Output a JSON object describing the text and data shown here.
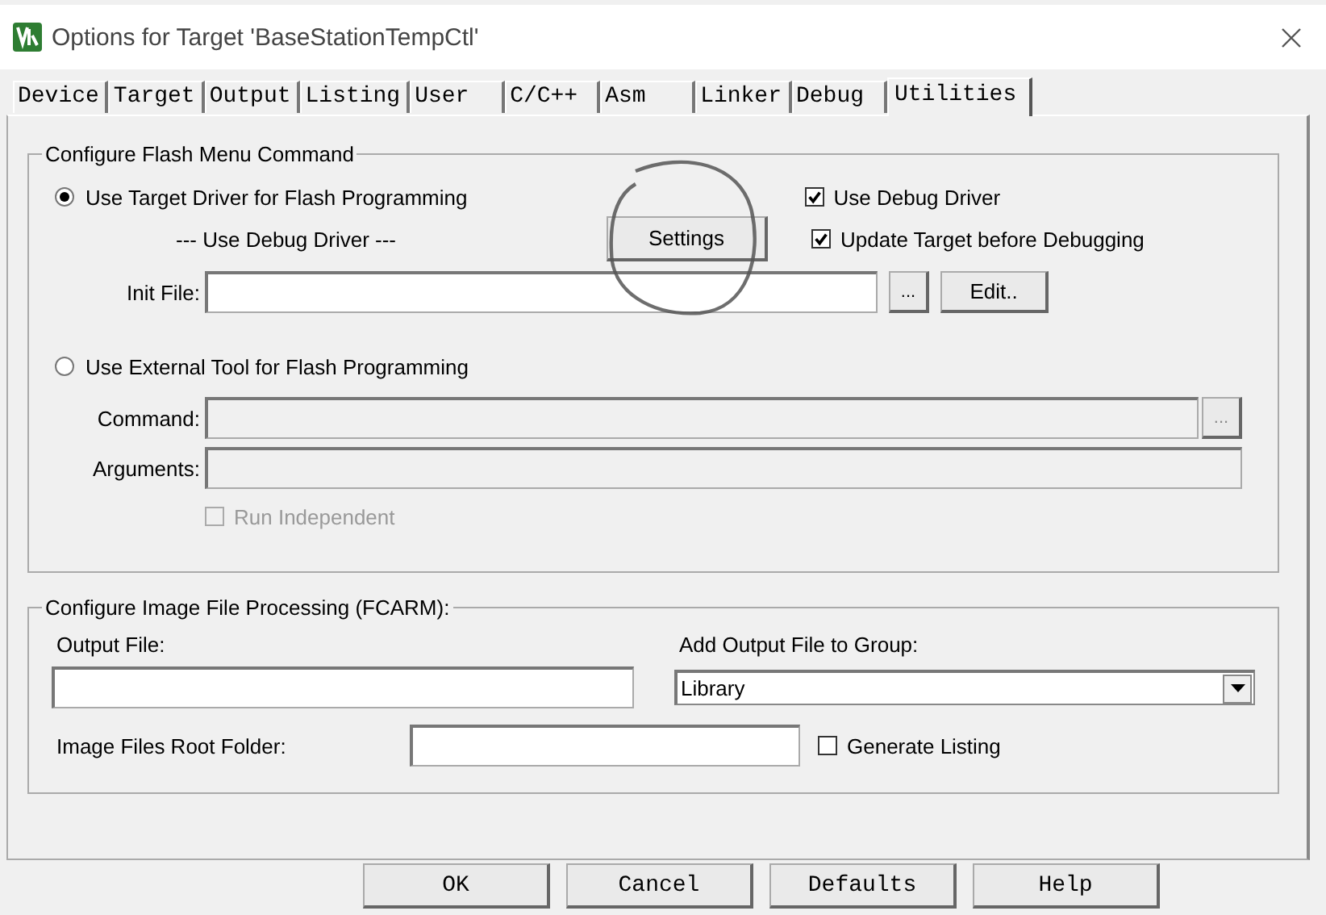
{
  "window": {
    "title": "Options for Target 'BaseStationTempCtl'"
  },
  "tabs": [
    {
      "label": "Device",
      "selected": false
    },
    {
      "label": "Target",
      "selected": false
    },
    {
      "label": "Output",
      "selected": false
    },
    {
      "label": "Listing",
      "selected": false
    },
    {
      "label": "User",
      "selected": false
    },
    {
      "label": "C/C++",
      "selected": false
    },
    {
      "label": "Asm",
      "selected": false
    },
    {
      "label": "Linker",
      "selected": false
    },
    {
      "label": "Debug",
      "selected": false
    },
    {
      "label": "Utilities",
      "selected": true
    }
  ],
  "flash_group": {
    "title": "Configure Flash Menu Command",
    "options": [
      {
        "label": "Use Target Driver for Flash Programming",
        "selected": true
      },
      {
        "label": "Use External Tool for Flash Programming",
        "selected": false
      }
    ],
    "driver_label": "--- Use Debug Driver ---",
    "settings_button": "Settings",
    "checkboxes": [
      {
        "label": "Use Debug Driver",
        "checked": true
      },
      {
        "label": "Update Target before Debugging",
        "checked": true
      }
    ],
    "init_file": {
      "label": "Init File:",
      "browse": "...",
      "edit": "Edit.."
    },
    "command": {
      "label": "Command:",
      "browse": "...",
      "disabled": true
    },
    "arguments": {
      "label": "Arguments:",
      "disabled": true
    },
    "run_independent": {
      "label": "Run Independent",
      "checked": false,
      "disabled": true
    }
  },
  "image_group": {
    "title": "Configure Image File Processing (FCARM):",
    "output_file": {
      "label": "Output File:"
    },
    "group": {
      "label": "Add Output File  to Group:",
      "value": "Library"
    },
    "root_folder": {
      "label": "Image Files Root Folder:"
    },
    "generate_listing": {
      "label": "Generate Listing",
      "checked": false
    }
  },
  "buttons": [
    {
      "label": "OK"
    },
    {
      "label": "Cancel"
    },
    {
      "label": "Defaults"
    },
    {
      "label": "Help"
    }
  ]
}
